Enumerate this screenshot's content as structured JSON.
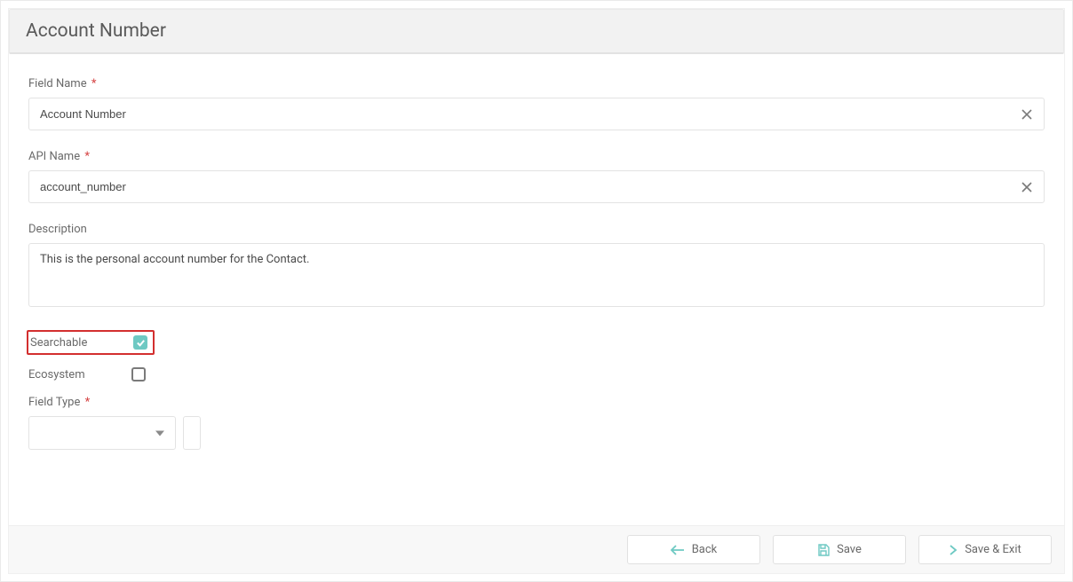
{
  "header": {
    "title": "Account Number"
  },
  "form": {
    "fieldName": {
      "label": "Field Name",
      "required": "*",
      "value": "Account Number"
    },
    "apiName": {
      "label": "API Name",
      "required": "*",
      "value": "account_number"
    },
    "description": {
      "label": "Description",
      "value": "This is the personal account number for the Contact."
    },
    "searchable": {
      "label": "Searchable",
      "checked": true
    },
    "ecosystem": {
      "label": "Ecosystem",
      "checked": false
    },
    "fieldType": {
      "label": "Field Type",
      "required": "*",
      "value": ""
    }
  },
  "footer": {
    "back": "Back",
    "save": "Save",
    "saveExit": "Save & Exit"
  },
  "colors": {
    "accent": "#6ec9c3",
    "highlight": "#d32f2f"
  }
}
